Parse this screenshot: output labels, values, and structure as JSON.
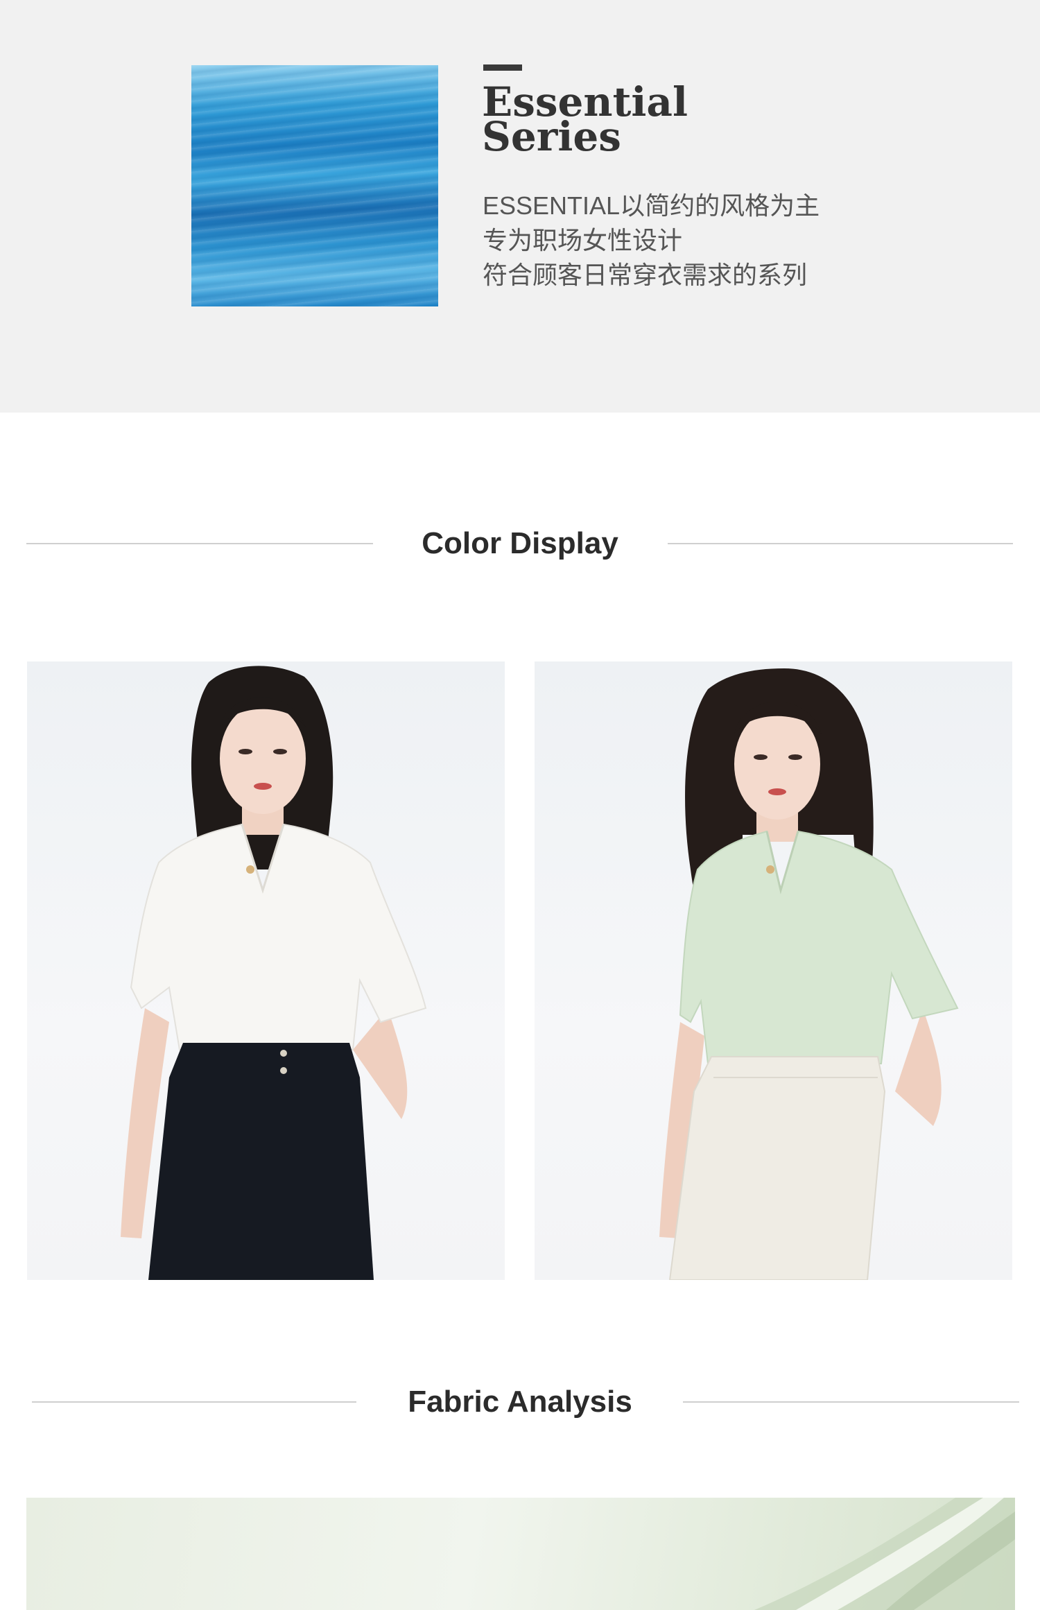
{
  "series": {
    "title_line1": "Essential",
    "title_line2": "Series",
    "description": [
      "ESSENTIAL以简约的风格为主",
      "专为职场女性设计",
      "符合顾客日常穿衣需求的系列"
    ]
  },
  "sections": {
    "color_display": "Color Display",
    "fabric_analysis": "Fabric Analysis"
  },
  "products": [
    {
      "color_name": "white",
      "top_color": "#f7f6f3",
      "bottom_color": "#161a22"
    },
    {
      "color_name": "mint-green",
      "top_color": "#d7e7d2",
      "bottom_color": "#efece4"
    }
  ],
  "colors": {
    "banner_bg": "#f1f1f1",
    "swatch_blue": "#1c7fc4",
    "heading_text": "#2b2b2b",
    "rule": "#cfcfcf"
  }
}
